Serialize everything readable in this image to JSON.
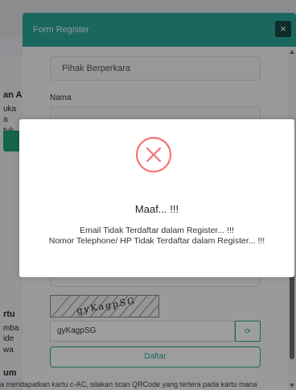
{
  "background": {
    "side_texts": [
      "an A",
      "uka",
      "a",
      "tuk",
      "rtu",
      "mba",
      "ide",
      "wa",
      "um"
    ],
    "bottom_text": "a mendapatkan kartu c-AC, silakan scan QRCode yang tertera pada kartu mana"
  },
  "modal": {
    "title": "Form Register",
    "close_glyph": "×",
    "pihak_value": "Pihak Berperkara",
    "nama_label": "Nama",
    "captcha_image_text": "gyKagpSG",
    "captcha_input_value": "gyKagpSG",
    "refresh_glyph": "⟳",
    "submit_label": "Daftar"
  },
  "alert": {
    "title": "Maaf... !!!",
    "message_line1": "Email Tidak Terdaftar dalam Register... !!!",
    "message_line2": "Nomor Telephone/ HP Tidak Terdaftar dalam Register... !!!",
    "icon": "error-x-icon",
    "icon_color": "#f27474"
  },
  "colors": {
    "accent": "#2aa79b"
  }
}
